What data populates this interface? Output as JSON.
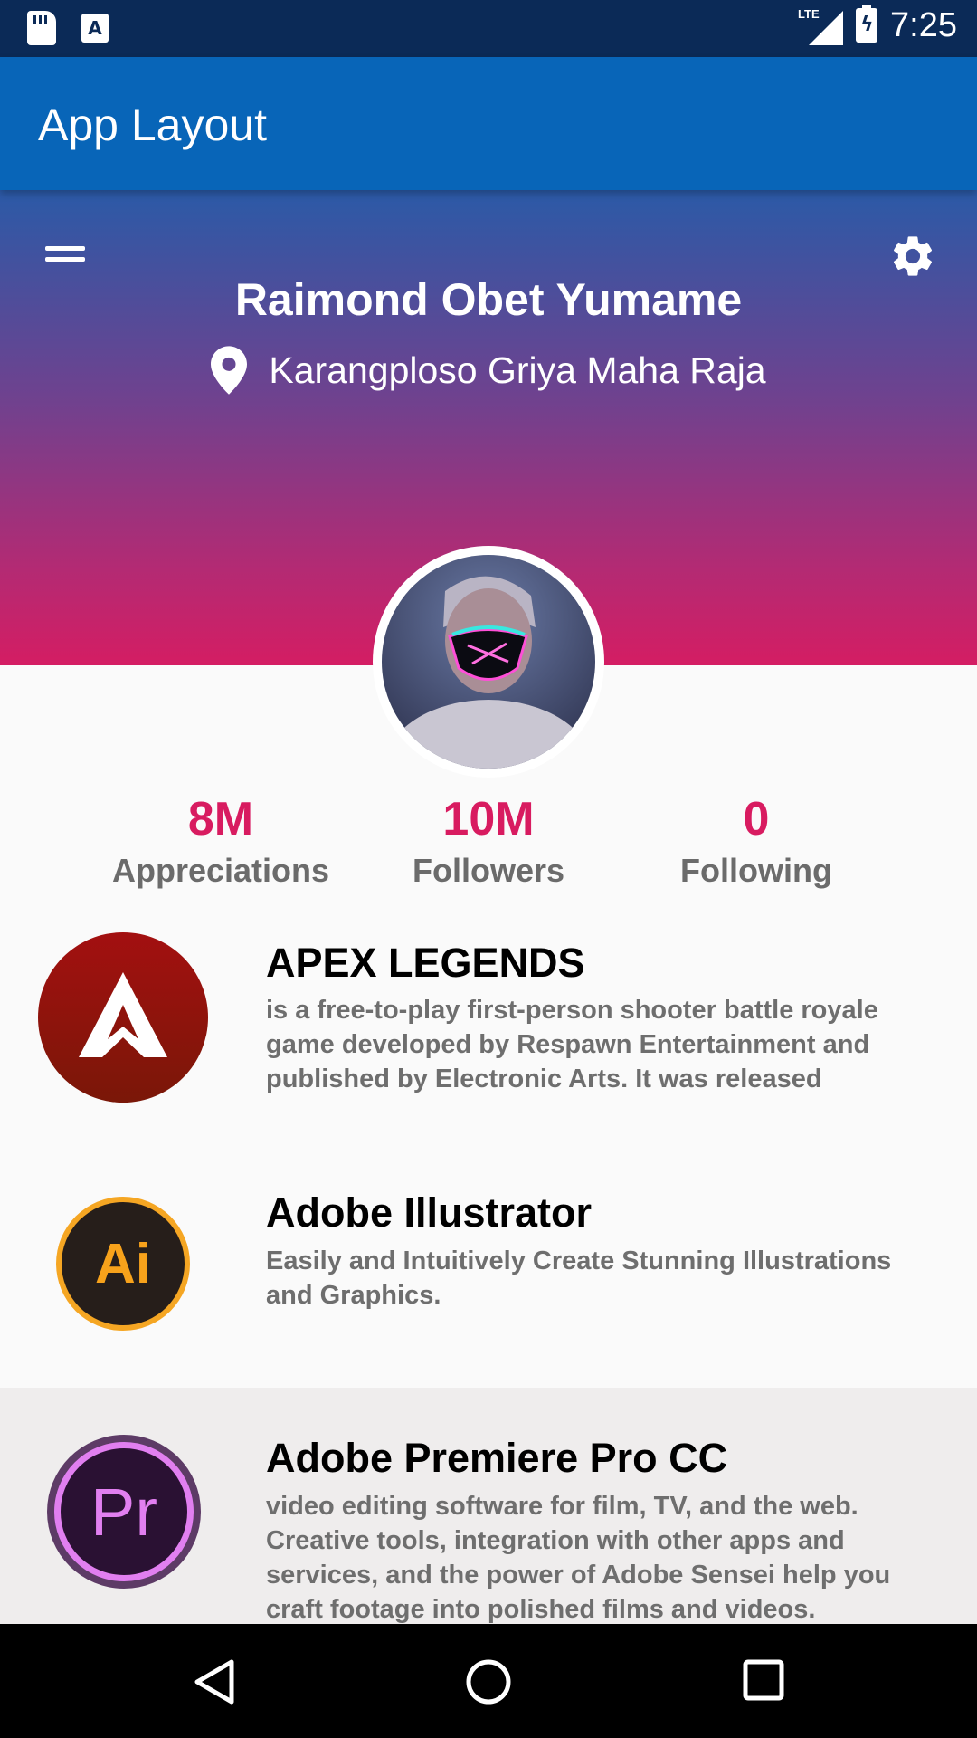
{
  "status_bar": {
    "time": "7:25",
    "network": "LTE",
    "a_badge": "A"
  },
  "app_bar": {
    "title": "App Layout"
  },
  "profile": {
    "name": "Raimond Obet Yumame",
    "location": "Karangploso Griya Maha Raja"
  },
  "stats": [
    {
      "value": "8M",
      "label": "Appreciations"
    },
    {
      "value": "10M",
      "label": "Followers"
    },
    {
      "value": "0",
      "label": "Following"
    }
  ],
  "items": [
    {
      "title": "APEX LEGENDS",
      "description": " is a free-to-play first-person shooter battle royale game developed by Respawn Entertainment and published by Electronic Arts. It was released",
      "icon": "apex-logo-icon"
    },
    {
      "title": "Adobe Illustrator",
      "description": "Easily and Intuitively Create Stunning Illustrations and Graphics.",
      "icon": "illustrator-logo-icon",
      "icon_text": "Ai"
    },
    {
      "title": "Adobe Premiere Pro CC",
      "description": "video editing software for film, TV, and the web. Creative tools, integration with other apps and services, and the power of Adobe Sensei help you craft footage into polished films and videos.",
      "icon": "premiere-logo-icon",
      "icon_text": "Pr"
    }
  ],
  "colors": {
    "accent": "#d81b60",
    "app_bar": "#0865b8",
    "status_bar": "#0b2a57"
  }
}
